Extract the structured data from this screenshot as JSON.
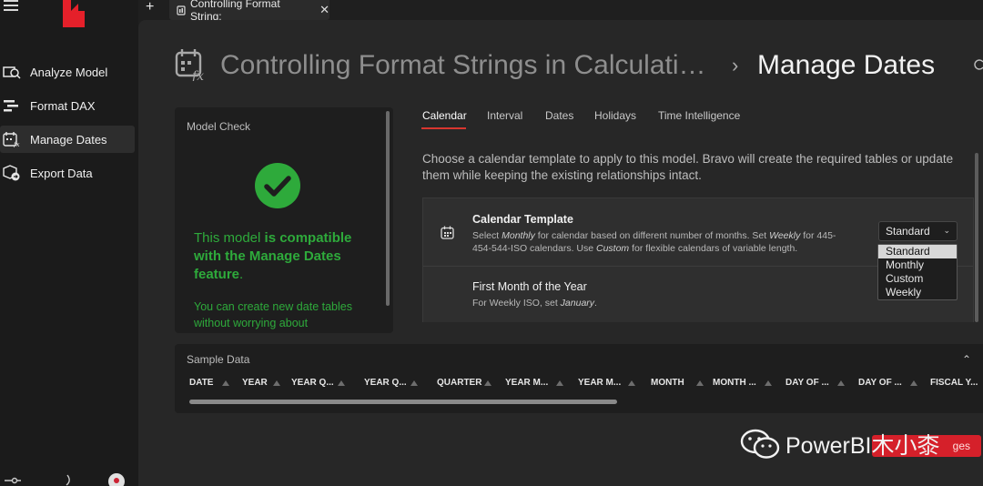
{
  "app": {
    "tab_title": "Controlling Format String:",
    "tab_close": "✕",
    "new_tab": "+"
  },
  "nav": {
    "items": [
      {
        "label": "Analyze Model",
        "icon": "analyze-model-icon"
      },
      {
        "label": "Format DAX",
        "icon": "format-dax-icon"
      },
      {
        "label": "Manage Dates",
        "icon": "manage-dates-icon",
        "active": true
      },
      {
        "label": "Export Data",
        "icon": "export-data-icon"
      }
    ]
  },
  "header": {
    "breadcrumb_parent": "Controlling Format Strings in Calculati…",
    "separator": "›",
    "page_title": "Manage Dates"
  },
  "model_check": {
    "heading": "Model Check",
    "message_pre": "This model ",
    "message_bold": "is compatible with the Manage Dates feature",
    "message_post": ".",
    "sub": "You can create new date tables without worrying about"
  },
  "tabs": [
    "Calendar",
    "Interval",
    "Dates",
    "Holidays",
    "Time Intelligence"
  ],
  "calendar": {
    "description": "Choose a calendar template to apply to this model. Bravo will create the required tables or update them while keeping the existing relationships intact.",
    "template": {
      "title": "Calendar Template",
      "desc_1": "Select ",
      "desc_2": "Monthly",
      "desc_3": " for calendar based on different number of months. Set ",
      "desc_4": "Weekly",
      "desc_5": " for 445-454-544-ISO calendars. Use ",
      "desc_6": "Custom",
      "desc_7": " for flexible calendars of variable length.",
      "selected": "Standard",
      "options": [
        "Standard",
        "Monthly",
        "Custom",
        "Weekly"
      ]
    },
    "first_month": {
      "title": "First Month of the Year",
      "desc_1": "For Weekly ISO, set ",
      "desc_2": "January",
      "desc_3": "."
    }
  },
  "sample_data": {
    "heading": "Sample Data",
    "columns": [
      "DATE",
      "YEAR",
      "YEAR Q...",
      "YEAR Q...",
      "QUARTER",
      "YEAR M...",
      "YEAR M...",
      "MONTH",
      "MONTH ...",
      "DAY OF ...",
      "DAY OF ...",
      "FISCAL Y..."
    ]
  },
  "footer": {
    "apply_label": "ges",
    "watermark": "PowerBI木小桼"
  },
  "colors": {
    "accent": "#d9362f",
    "success": "#2eaa3b",
    "background": "#1f1f1f",
    "panel": "#272727"
  }
}
